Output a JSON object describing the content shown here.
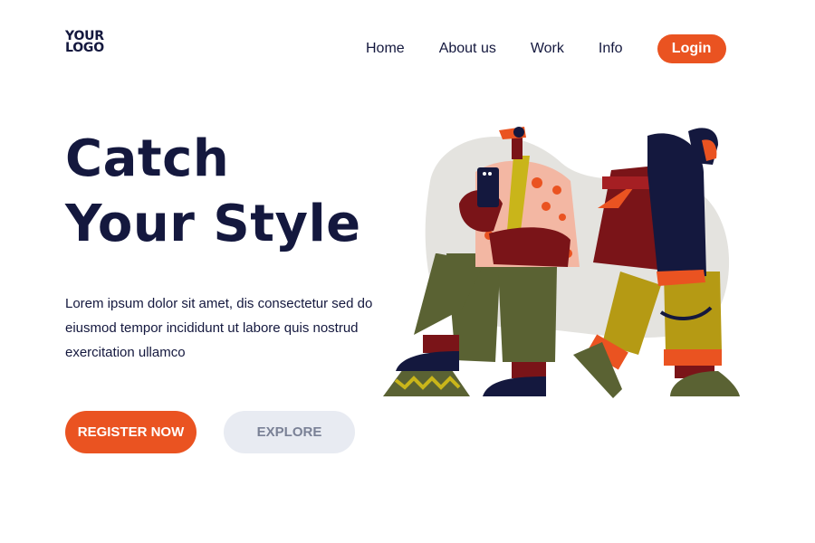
{
  "header": {
    "logo_line1": "YOUR",
    "logo_line2": "LOGO",
    "nav": [
      "Home",
      "About us",
      "Work",
      "Info"
    ],
    "login_label": "Login"
  },
  "hero": {
    "title_line1": "Catch",
    "title_line2": "Your Style",
    "description": "Lorem ipsum dolor sit amet,  dis consectetur sed do eiusmod tempor incididunt ut labore quis nostrud exercitation ullamco",
    "register_label": "REGISTER NOW",
    "explore_label": "EXPLORE"
  },
  "colors": {
    "accent": "#ea5321",
    "navy": "#14183e",
    "explore_bg": "#e8ebf2",
    "explore_text": "#7a8196"
  }
}
